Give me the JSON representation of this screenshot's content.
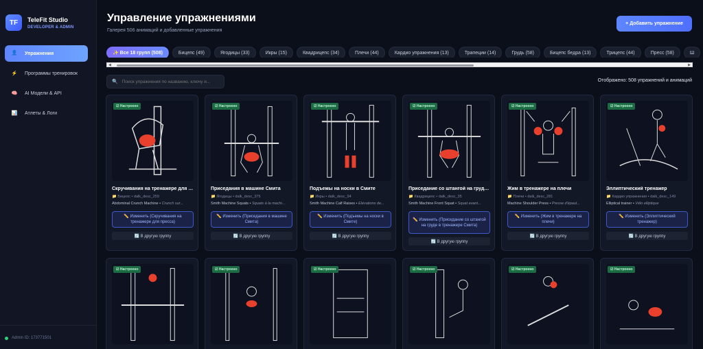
{
  "brand": {
    "logo": "TF",
    "title": "TeleFit Studio",
    "subtitle": "DEVELOPER & ADMIN"
  },
  "sidebar": {
    "items": [
      {
        "label": "Упражнения",
        "icon": "person-icon",
        "glyph": "👤",
        "active": true
      },
      {
        "label": "Программы тренировок",
        "icon": "lightning-icon",
        "glyph": "⚡",
        "active": false
      },
      {
        "label": "AI Модели & API",
        "icon": "brain-icon",
        "glyph": "🧠",
        "active": false
      },
      {
        "label": "Атлеты & Логи",
        "icon": "chart-icon",
        "glyph": "📊",
        "active": false
      }
    ],
    "admin_id": "Admin ID: 173771501"
  },
  "header": {
    "title": "Управление упражнениями",
    "subtitle": "Галерея 506 анимаций и добавленные упражнения",
    "add_button": "+ Добавить упражнение"
  },
  "chips": [
    "✨ Все 18 групп (508)",
    "Бицепс (49)",
    "Ягодицы (33)",
    "Икры (15)",
    "Квадрицепс (34)",
    "Плечи (44)",
    "Кардио упражнения (13)",
    "Трапеции (14)",
    "Грудь (58)",
    "Бицепс бедра (13)",
    "Трицепс (44)",
    "Пресс (58)",
    "Ш"
  ],
  "search": {
    "placeholder": "Поиск упражнения по названию, ключу и..."
  },
  "count_label": "Отображено: 508 упражнений и анимаций",
  "badge_label": "☑ Настроено",
  "move_label": "🔄 В другую группу",
  "cards": [
    {
      "title": "Скручивания на тренажере для п...",
      "meta": "📁 Бицепс • dalk_desc_259",
      "name_en": "Abdominal Crunch Machine",
      "name_fr": "Crunch sur...",
      "edit": "✏️ Изменить (Скручивания на тренажере для пресса)"
    },
    {
      "title": "Приседания в машине Смита",
      "meta": "📁 Ягодицы • dalk_desc_375",
      "name_en": "Smith Machine Squats",
      "name_fr": "Squats à la machi...",
      "edit": "✏️ Изменить (Приседания в машине Смита)"
    },
    {
      "title": "Подъемы на носки в Смите",
      "meta": "📁 Икры • dalk_desc_94",
      "name_en": "Smith Machine Calf Raises",
      "name_fr": "Élévations de...",
      "edit": "✏️ Изменить (Подъемы на носки в Смите)"
    },
    {
      "title": "Приседание со штангой на груди ...",
      "meta": "📁 Квадрицепс • dalk_desc_35",
      "name_en": "Smith Machine Front Squat",
      "name_fr": "Squat avant...",
      "edit": "✏️ Изменить (Приседание со штангой на груде в тренажере Смита)"
    },
    {
      "title": "Жим в тренажере на плечи",
      "meta": "📁 Плечи • dalk_desc_281",
      "name_en": "Machine Shoulder Press",
      "name_fr": "Presse d'épaul...",
      "edit": "✏️ Изменить (Жим в тренажере на плечи)"
    },
    {
      "title": "Эллиптический тренажер",
      "meta": "📁 Кардио упражнения • dalk_desc_149",
      "name_en": "Elliptical trainer",
      "name_fr": "Vélo elliptique",
      "edit": "✏️ Изменить (Эллиптический тренажер)"
    }
  ],
  "colors": {
    "accent": "#5f86ff",
    "muscle": "#e8402c",
    "badge": "#1d6b45",
    "background": "#0b0f19"
  }
}
